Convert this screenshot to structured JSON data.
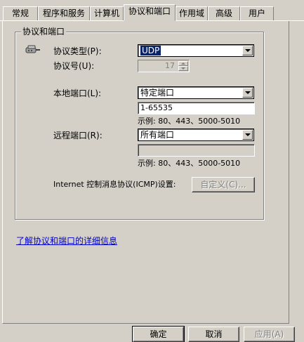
{
  "tabs": [
    {
      "label": "常规",
      "active": false
    },
    {
      "label": "程序和服务",
      "active": false
    },
    {
      "label": "计算机",
      "active": false
    },
    {
      "label": "协议和端口",
      "active": true
    },
    {
      "label": "作用域",
      "active": false
    },
    {
      "label": "高级",
      "active": false
    },
    {
      "label": "用户",
      "active": false
    }
  ],
  "group": {
    "title": "协议和端口",
    "protocol_type": {
      "label": "协议类型(P):",
      "value": "UDP"
    },
    "protocol_number": {
      "label": "协议号(U):",
      "value": "17"
    },
    "local_port": {
      "label": "本地端口(L):",
      "selected": "特定端口",
      "value": "1-65535",
      "example": "示例: 80、443、5000-5010"
    },
    "remote_port": {
      "label": "远程端口(R):",
      "selected": "所有端口",
      "value": "",
      "example": "示例: 80、443、5000-5010"
    },
    "icmp": {
      "label": "Internet 控制消息协议(ICMP)设置:",
      "button": "自定义(C)..."
    }
  },
  "link": "了解协议和端口的详细信息",
  "buttons": {
    "ok": "确定",
    "cancel": "取消",
    "apply": "应用(A)"
  }
}
